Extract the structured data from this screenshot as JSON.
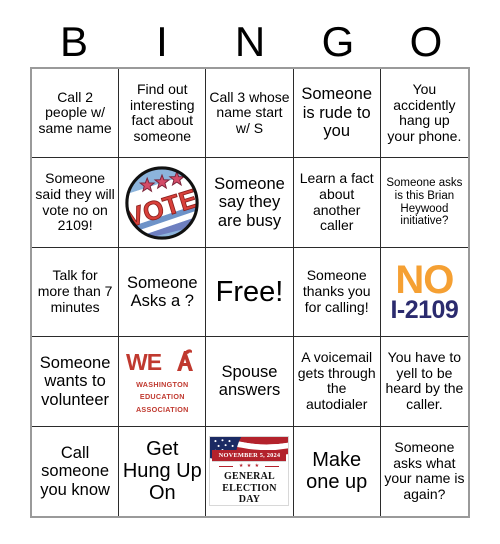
{
  "header": {
    "letters": [
      "B",
      "I",
      "N",
      "G",
      "O"
    ]
  },
  "colors": {
    "no_orange": "#F5A033",
    "no_navy": "#2B2B6E",
    "wea_red": "#C0392F",
    "ribbon_red": "#B3222C",
    "vote_blue": "#8CB4DC",
    "vote_red": "#D8403A",
    "grid_line": "#2b2b2b"
  },
  "grid": {
    "rows": 5,
    "columns": 5,
    "cells": [
      {
        "id": "b1",
        "type": "text",
        "text": "Call 2 people w/ same name",
        "size": "sz-s"
      },
      {
        "id": "i1",
        "type": "text",
        "text": "Find out interesting fact about someone",
        "size": "sz-s"
      },
      {
        "id": "n1",
        "type": "text",
        "text": "Call 3 whose name start w/ S",
        "size": "sz-s"
      },
      {
        "id": "g1",
        "type": "text",
        "text": "Someone is rude to you",
        "size": "sz-m"
      },
      {
        "id": "o1",
        "type": "text",
        "text": "You accidently hang up your phone.",
        "size": "sz-s"
      },
      {
        "id": "b2",
        "type": "text",
        "text": "Someone said they will vote no on 2109!",
        "size": "sz-s"
      },
      {
        "id": "i2",
        "type": "image",
        "image": "vote-button-badge",
        "alt": "VOTE campaign button"
      },
      {
        "id": "n2",
        "type": "text",
        "text": "Someone say they are busy",
        "size": "sz-m"
      },
      {
        "id": "g2",
        "type": "text",
        "text": "Learn a fact about another caller",
        "size": "sz-s"
      },
      {
        "id": "o2",
        "type": "text",
        "text": "Someone asks is this Brian Heywood initiative?",
        "size": "sz-xs"
      },
      {
        "id": "b3",
        "type": "text",
        "text": "Talk for more than 7 minutes",
        "size": "sz-s"
      },
      {
        "id": "i3",
        "type": "text",
        "text": "Someone Asks a ?",
        "size": "sz-m"
      },
      {
        "id": "n3",
        "type": "text",
        "text": "Free!",
        "size": "sz-xl"
      },
      {
        "id": "g3",
        "type": "text",
        "text": "Someone thanks you for calling!",
        "size": "sz-s"
      },
      {
        "id": "o3",
        "type": "image",
        "image": "no-i-2109-logo",
        "alt": "NO I-2109 logo",
        "logo_line1": "NO",
        "logo_line2": "I-2109"
      },
      {
        "id": "b4",
        "type": "text",
        "text": "Someone wants to volunteer",
        "size": "sz-m"
      },
      {
        "id": "i4",
        "type": "image",
        "image": "wea-logo",
        "alt": "WEA logo",
        "logo_mark": "WEA",
        "logo_sub": "WASHINGTON\nEDUCATION\nASSOCIATION"
      },
      {
        "id": "n4",
        "type": "text",
        "text": "Spouse answers",
        "size": "sz-m"
      },
      {
        "id": "g4",
        "type": "text",
        "text": "A voicemail gets through the autodialer",
        "size": "sz-s"
      },
      {
        "id": "o4",
        "type": "text",
        "text": "You have to yell to be heard by the caller.",
        "size": "sz-s"
      },
      {
        "id": "b5",
        "type": "text",
        "text": "Call someone you know",
        "size": "sz-m"
      },
      {
        "id": "i5",
        "type": "text",
        "text": "Get Hung Up On",
        "size": "sz-l"
      },
      {
        "id": "n5",
        "type": "image",
        "image": "general-election-day-graphic",
        "alt": "General Election Day November 5, 2024",
        "date_text": "NOVEMBER 5, 2024",
        "title_line1": "GENERAL",
        "title_line2": "ELECTION",
        "title_line3": "DAY",
        "stars": "★ ★ ★"
      },
      {
        "id": "g5",
        "type": "text",
        "text": "Make one up",
        "size": "sz-l"
      },
      {
        "id": "o5",
        "type": "text",
        "text": "Someone asks what your name is again?",
        "size": "sz-s"
      }
    ]
  },
  "vote_badge": {
    "word": "VOTE",
    "star_count": 3
  }
}
